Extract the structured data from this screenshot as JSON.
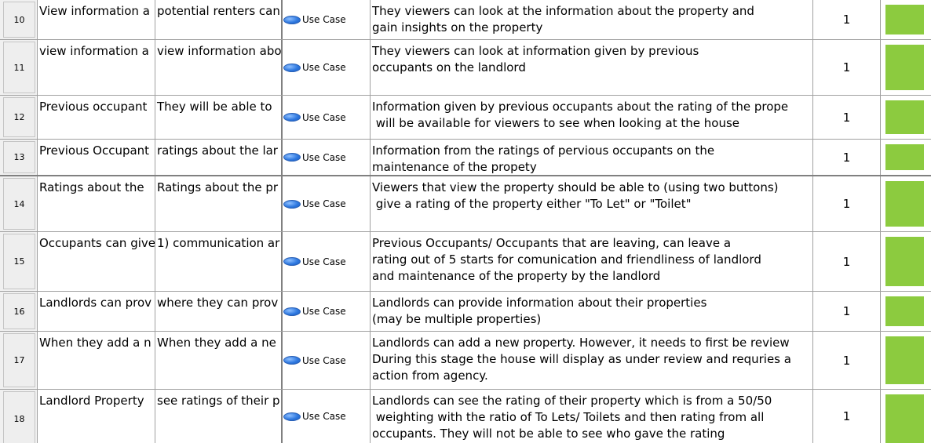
{
  "colors": {
    "status_fill": "#8ccb3f",
    "use_case_icon": "#2f79e0",
    "grid_line": "#a0a0a0"
  },
  "use_case_icon_name": "use-case-ellipse-icon",
  "rows": [
    {
      "id": "10",
      "name": "View information a",
      "description": "potential renters can",
      "type": "Use Case",
      "text": "They viewers can look at the information about the property and\ngain insights on the property",
      "priority": "1"
    },
    {
      "id": "11",
      "name": "view information a",
      "description": "view information abo",
      "type": "Use Case",
      "text": "They viewers can look at information given by previous\noccupants on the landlord",
      "priority": "1"
    },
    {
      "id": "12",
      "name": "Previous occupant",
      "description": "They will be able to",
      "type": "Use Case",
      "text": "Information given by previous occupants about the rating of the prope\n will be available for viewers to see when looking at the house",
      "priority": "1"
    },
    {
      "id": "13",
      "name": "Previous Occupant",
      "description": "ratings about the lar",
      "type": "Use Case",
      "text": "Information from the ratings of pervious occupants on the\nmaintenance of the propety",
      "priority": "1"
    },
    {
      "id": "14",
      "name": "Ratings about the",
      "description": "Ratings about the pr",
      "type": "Use Case",
      "text": "Viewers that view the property should be able to (using two buttons)\n give a rating of the property either \"To Let\" or \"Toilet\"",
      "priority": "1"
    },
    {
      "id": "15",
      "name": "Occupants can give",
      "description": "1) communication ar",
      "type": "Use Case",
      "text": "Previous Occupants/ Occupants that are leaving, can leave a\nrating out of 5 starts for comunication and friendliness of landlord\nand maintenance of the property by the landlord",
      "priority": "1"
    },
    {
      "id": "16",
      "name": "Landlords can prov",
      "description": "where they can prov",
      "type": "Use Case",
      "text": "Landlords can provide information about their properties\n(may be multiple properties)",
      "priority": "1"
    },
    {
      "id": "17",
      "name": "When they add a n",
      "description": "When they add a ne",
      "type": "Use Case",
      "text": "Landlords can add a new property. However, it needs to first be review\nDuring this stage the house will display as under review and requries a\naction from agency.",
      "priority": "1"
    },
    {
      "id": "18",
      "name": "Landlord Property",
      "description": "see ratings of their p",
      "type": "Use Case",
      "text": "Landlords can see the rating of their property which is from a 50/50\n weighting with the ratio of To Lets/ Toilets and then rating from all\noccupants. They will not be able to see who gave the rating",
      "priority": "1"
    }
  ]
}
